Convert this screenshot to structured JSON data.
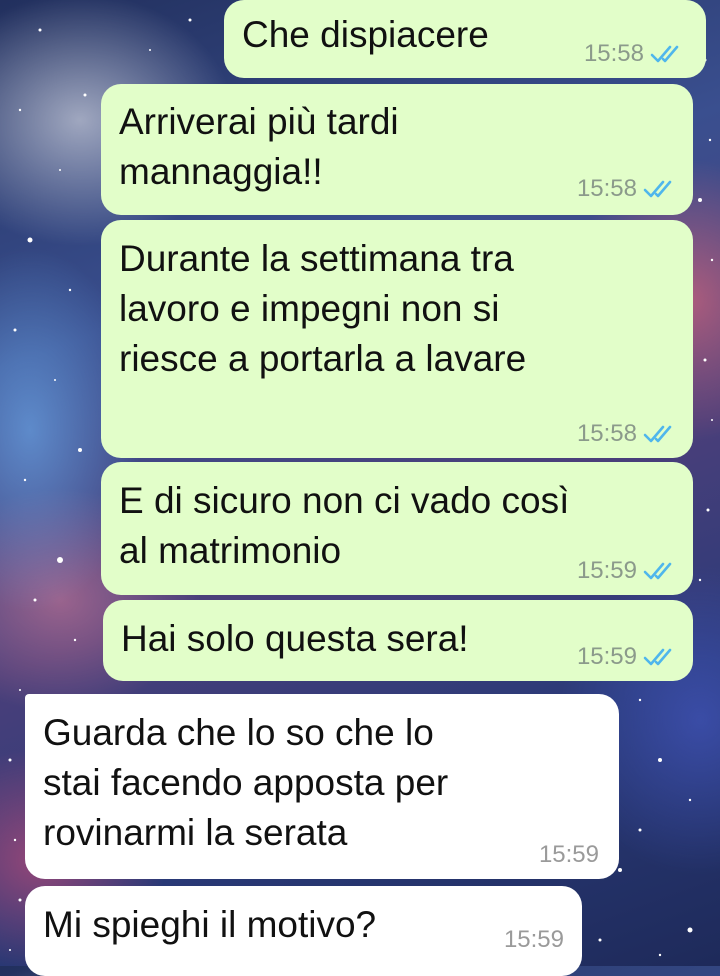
{
  "colors": {
    "outgoing_bubble": "#e2fec9",
    "incoming_bubble": "#ffffff",
    "read_ticks": "#4fb6ec",
    "timestamp": "#8b9a8b"
  },
  "messages": [
    {
      "direction": "outgoing",
      "text": "Che dispiacere",
      "time": "15:58",
      "status": "read-ticks-icon"
    },
    {
      "direction": "outgoing",
      "text": "Arriverai più tardi\nmannaggia!!",
      "time": "15:58",
      "status": "read-ticks-icon"
    },
    {
      "direction": "outgoing",
      "text": "Durante la settimana tra\nlavoro e impegni non si\nriesce a portarla a lavare",
      "time": "15:58",
      "status": "read-ticks-icon"
    },
    {
      "direction": "outgoing",
      "text": "E di sicuro non ci vado così\nal matrimonio",
      "time": "15:59",
      "status": "read-ticks-icon"
    },
    {
      "direction": "outgoing",
      "text": "Hai solo questa sera!",
      "time": "15:59",
      "status": "read-ticks-icon"
    },
    {
      "direction": "incoming",
      "text": "Guarda che lo so che lo\nstai facendo apposta per\nrovinarmi la serata",
      "time": "15:59"
    },
    {
      "direction": "incoming",
      "text": "Mi spieghi il motivo?",
      "time": "15:59"
    }
  ]
}
